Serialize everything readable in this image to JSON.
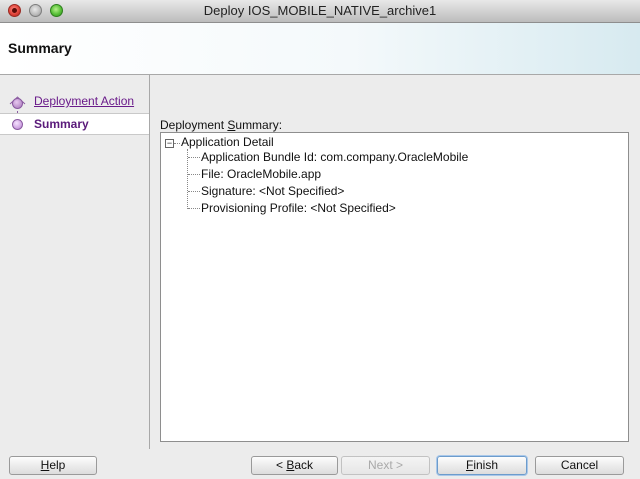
{
  "window": {
    "title": "Deploy IOS_MOBILE_NATIVE_archive1"
  },
  "header": {
    "title": "Summary"
  },
  "nav": {
    "steps": [
      {
        "label": "Deployment Action",
        "state": "visited"
      },
      {
        "label": "Summary",
        "state": "current"
      }
    ]
  },
  "content": {
    "summary_label_pre": "Deployment ",
    "summary_label_mnemonic": "S",
    "summary_label_post": "ummary:",
    "tree": {
      "root": "Application Detail",
      "expanded": true,
      "items": [
        "Application Bundle Id:  com.company.OracleMobile",
        "File:  OracleMobile.app",
        "Signature:  <Not Specified>",
        "Provisioning Profile:  <Not Specified>"
      ]
    }
  },
  "buttons": {
    "help_mnemonic": "H",
    "help_rest": "elp",
    "back_pre": "< ",
    "back_mnemonic": "B",
    "back_rest": "ack",
    "next": "Next >",
    "finish_mnemonic": "F",
    "finish_rest": "inish",
    "cancel": "Cancel"
  },
  "colors": {
    "nav_link": "#6a1b8a",
    "nav_current": "#5a1a7a",
    "default_button_ring": "#6d9ccc"
  }
}
